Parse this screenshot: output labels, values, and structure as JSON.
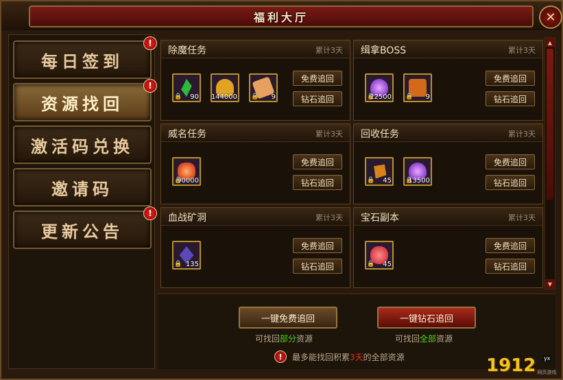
{
  "window": {
    "title": "福利大厅",
    "close_symbol": "✕"
  },
  "sidebar": {
    "items": [
      {
        "label": "每日签到",
        "active": false,
        "alert": true
      },
      {
        "label": "资源找回",
        "active": true,
        "alert": true
      },
      {
        "label": "激活码兑换",
        "active": false,
        "alert": false
      },
      {
        "label": "邀请码",
        "active": false,
        "alert": false
      },
      {
        "label": "更新公告",
        "active": false,
        "alert": true
      }
    ],
    "alert_symbol": "!"
  },
  "cards": [
    {
      "title": "除魔任务",
      "days": "累计3天",
      "items": [
        {
          "icon": "green-crystal-icon",
          "count": "90",
          "color": "#2fb83a"
        },
        {
          "icon": "gold-ingot-icon",
          "count": "144000",
          "color": "#e0a422"
        },
        {
          "icon": "scroll-icon",
          "count": "9",
          "color": "#e8a060"
        }
      ]
    },
    {
      "title": "缉拿BOSS",
      "days": "累计3天",
      "items": [
        {
          "icon": "purple-flame-icon",
          "count": "22500",
          "color": "#a838e8"
        },
        {
          "icon": "treasure-chest-icon",
          "count": "9",
          "color": "#d26a1a"
        }
      ]
    },
    {
      "title": "威名任务",
      "days": "累计3天",
      "items": [
        {
          "icon": "red-pouch-icon",
          "count": "90000",
          "color": "#d83a1a"
        }
      ]
    },
    {
      "title": "回收任务",
      "days": "累计3天",
      "items": [
        {
          "icon": "orange-ore-icon",
          "count": "45",
          "color": "#d8821a"
        },
        {
          "icon": "purple-flame-icon",
          "count": "13500",
          "color": "#a838e8"
        }
      ]
    },
    {
      "title": "血战矿洞",
      "days": "累计3天",
      "items": [
        {
          "icon": "blue-crystal-icon",
          "count": "135",
          "color": "#5a4ab8"
        }
      ]
    },
    {
      "title": "宝石副本",
      "days": "累计3天",
      "items": [
        {
          "icon": "gem-bag-icon",
          "count": "45",
          "color": "#d82a3a"
        }
      ]
    }
  ],
  "card_buttons": {
    "free": "免费追回",
    "diamond": "钻石追回"
  },
  "bottom": {
    "free_all": "一键免费追回",
    "diamond_all": "一键钻石追回",
    "free_hint_prefix": "可找回",
    "free_hint_em": "部分",
    "free_hint_suffix": "资源",
    "diamond_hint_prefix": "可找回",
    "diamond_hint_em": "全部",
    "diamond_hint_suffix": "资源",
    "warn_prefix": "最多能找回积累",
    "warn_em": "3天",
    "warn_suffix": "的全部资源",
    "warn_symbol": "!"
  },
  "scrollbar": {
    "up": "▲",
    "down": "▼"
  },
  "watermark": {
    "number": "1912",
    "yx": "yx",
    "sub": "网页游戏"
  },
  "colors": {
    "accent_red": "#a82a1a",
    "highlight_green": "#4ad81a",
    "warn_red": "#e83020"
  }
}
